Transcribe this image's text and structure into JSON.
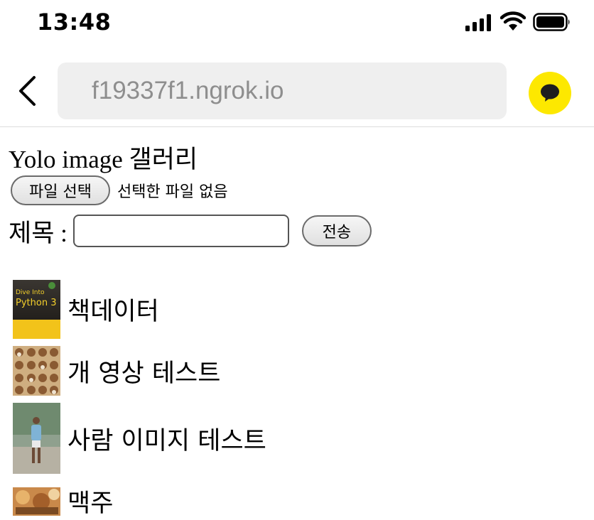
{
  "status_bar": {
    "time": "13:48",
    "icons": [
      "cellular-signal-icon",
      "wifi-icon",
      "battery-icon"
    ]
  },
  "browser": {
    "url": "f19337f1.ngrok.io",
    "back_icon": "chevron-left-icon",
    "kakao_icon": "kakaotalk-chat-icon",
    "kakao_color": "#fde800"
  },
  "page": {
    "title": "Yolo image 갤러리",
    "file_button_label": "파일 선택",
    "file_status": "선택한 파일 없음",
    "title_label": "제목 :",
    "title_input_value": "",
    "submit_label": "전송"
  },
  "gallery": {
    "items": [
      {
        "label": "책데이터",
        "thumb_text_1": "Dive Into",
        "thumb_text_2": "Python 3"
      },
      {
        "label": "개 영상 테스트"
      },
      {
        "label": "사람 이미지 테스트"
      },
      {
        "label": "맥주"
      }
    ]
  }
}
